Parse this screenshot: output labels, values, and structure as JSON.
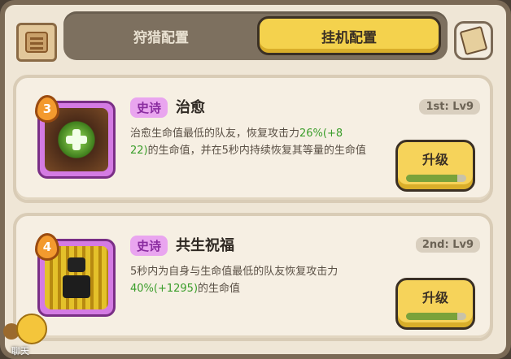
{
  "tabs": {
    "hunt": "狩猎配置",
    "idle": "挂机配置"
  },
  "icons": {
    "left": "scroll-icon",
    "right": "note-icon"
  },
  "skills": [
    {
      "badge": "3",
      "rarity": "史诗",
      "name": "治愈",
      "level": "1st: Lv9",
      "desc": {
        "p1": "治愈生命值最低的队友，恢复攻击力",
        "v1": "26%",
        "v2": "(+8",
        "p2": "22)",
        "p3": "的生命值，并在5秒内持续恢复其等量的生命值"
      },
      "upgrade": "升级",
      "progress": 0.85
    },
    {
      "badge": "4",
      "rarity": "史诗",
      "name": "共生祝福",
      "level": "2nd: Lv9",
      "desc": {
        "p1": "5秒内为自身与生命值最低的队友恢复攻击力",
        "v1": "40%",
        "v2": "(+1295)",
        "p2": "",
        "p3": "的生命值"
      },
      "upgrade": "升级",
      "progress": 0.85
    }
  ],
  "chat": {
    "label": "聊天"
  }
}
